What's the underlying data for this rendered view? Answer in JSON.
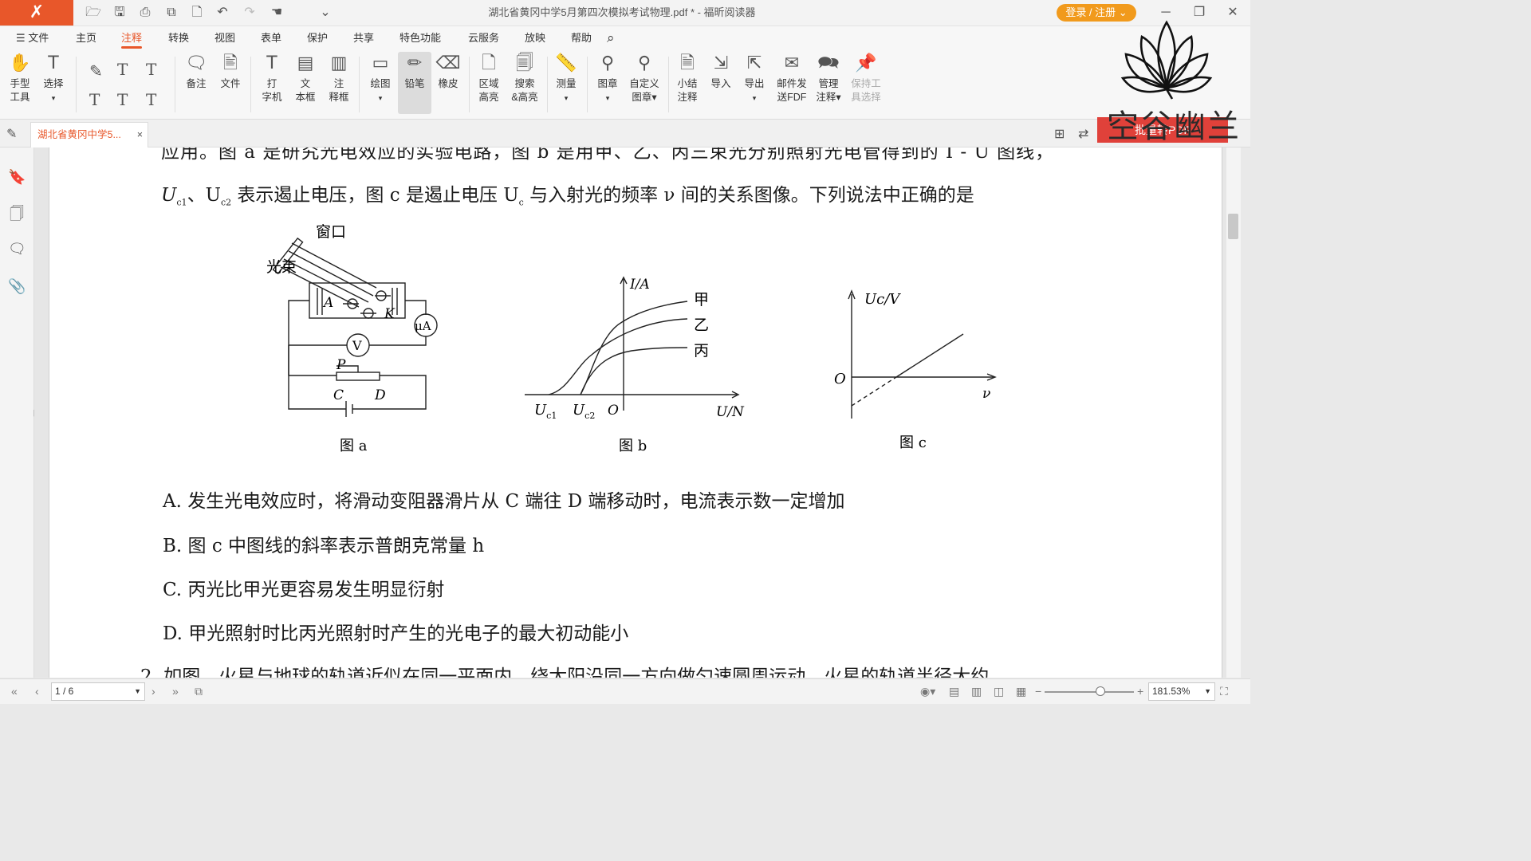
{
  "window": {
    "title": "湖北省黄冈中学5月第四次模拟考试物理.pdf * - 福昕阅读器",
    "login_label": "登录 / 注册",
    "logo": "Foxit"
  },
  "menu": [
    "文件",
    "主页",
    "注释",
    "转换",
    "视图",
    "表单",
    "保护",
    "共享",
    "特色功能",
    "云服务",
    "放映",
    "帮助"
  ],
  "active_menu": "注释",
  "toolbar": {
    "hand": "手型\n工具",
    "select": "选择",
    "note": "备注",
    "file": "文件",
    "typewriter": "打\n字机",
    "textbox": "文\n本框",
    "callout": "注\n释框",
    "drawing": "绘图",
    "pencil": "铅笔",
    "eraser": "橡皮",
    "area_highlight": "区域\n高亮",
    "search_highlight": "搜索\n&高亮",
    "measure": "测量",
    "stamp": "图章",
    "custom_stamp": "自定义\n图章",
    "summarize": "小结\n注释",
    "import": "导入",
    "export": "导出",
    "email_fdf": "邮件发\n送FDF",
    "manage": "管理\n注释",
    "keep_tool": "保持工\n具选择"
  },
  "tab": {
    "label": "湖北省黄冈中学5...",
    "close": "×"
  },
  "document": {
    "line0": "应用。图 a 是研究光电效应的实验电路，图 b 是用甲、乙、丙三束光分别照射光电管得到的 I - U 图线，",
    "line1_a": "U",
    "line1_c1": "c1",
    "line1_b": "、U",
    "line1_c2": "c2",
    "line1_rest": " 表示遏止电压，图 c 是遏止电压 U",
    "line1_c": "c",
    "line1_end": " 与入射光的频率 ν 间的关系图像。下列说法中正确的是",
    "fig_a": {
      "caption": "图 a",
      "window": "窗口",
      "beam": "光束",
      "A": "A",
      "K": "K",
      "uA": "μA",
      "V": "V",
      "P": "P",
      "C": "C",
      "D": "D"
    },
    "fig_b": {
      "caption": "图 b",
      "ylabel": "I/A",
      "xlabel": "U/N",
      "jia": "甲",
      "yi": "乙",
      "bing": "丙",
      "uc1": "U",
      "uc1_sub": "c1",
      "uc2": "U",
      "uc2_sub": "c2",
      "origin": "O"
    },
    "fig_c": {
      "caption": "图 c",
      "ylabel": "Uc/V",
      "xlabel": "ν",
      "origin": "O"
    },
    "optA": "A. 发生光电效应时，将滑动变阻器滑片从 C 端往 D 端移动时，电流表示数一定增加",
    "optB": "B. 图 c 中图线的斜率表示普朗克常量 h",
    "optC": "C. 丙光比甲光更容易发生明显衍射",
    "optD": "D. 甲光照射时比丙光照射时产生的光电子的最大初动能小",
    "next": "2. 如图，火星与地球的轨道近似在同一平面内，绕太阳沿同一方向做匀速圆周运动，火星的轨道半径大约"
  },
  "status": {
    "page": "1 / 6",
    "zoom": "181.53%"
  },
  "watermark": {
    "text": "空谷幽兰",
    "button": "批量转PDF"
  }
}
